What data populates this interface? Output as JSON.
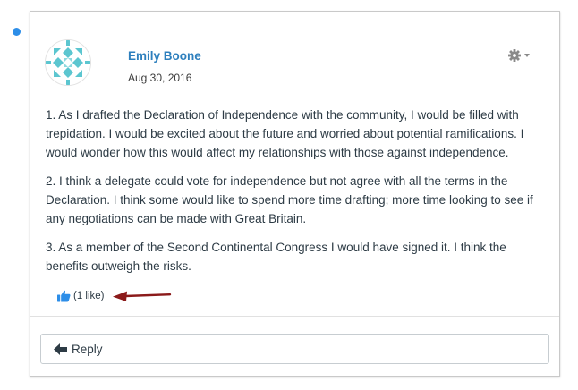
{
  "entry": {
    "author_name": "Emily Boone",
    "date": "Aug 30, 2016",
    "paragraphs": [
      "1. As I drafted the Declaration of Independence with the community, I would be filled with trepidation. I would be excited about the future and worried about potential ramifications. I would wonder how this would affect my relationships with those against independence.",
      "2. I think a delegate could vote for independence but not agree with all the terms in the Declaration. I think some would like to spend more time drafting; more time looking to see if any negotiations can be made with Great Britain.",
      "3. As a member of the Second Continental Congress I would have signed it. I think the benefits outweigh the risks."
    ],
    "like_count_label": "(1 like)"
  },
  "reply": {
    "label": "Reply"
  },
  "icons": {
    "unread": "unread-dot",
    "settings": "gear-icon",
    "menu": "chevron-down-icon",
    "like": "thumbs-up-icon",
    "reply": "reply-arrow-icon",
    "annotation": "red-arrow-annotation"
  },
  "colors": {
    "unread_dot": "#2d8ee8",
    "author_link": "#2d7fbd",
    "like_icon": "#2d8ee8",
    "annotation_arrow": "#8b1a1a",
    "avatar_pattern": "#5cc6d0"
  }
}
